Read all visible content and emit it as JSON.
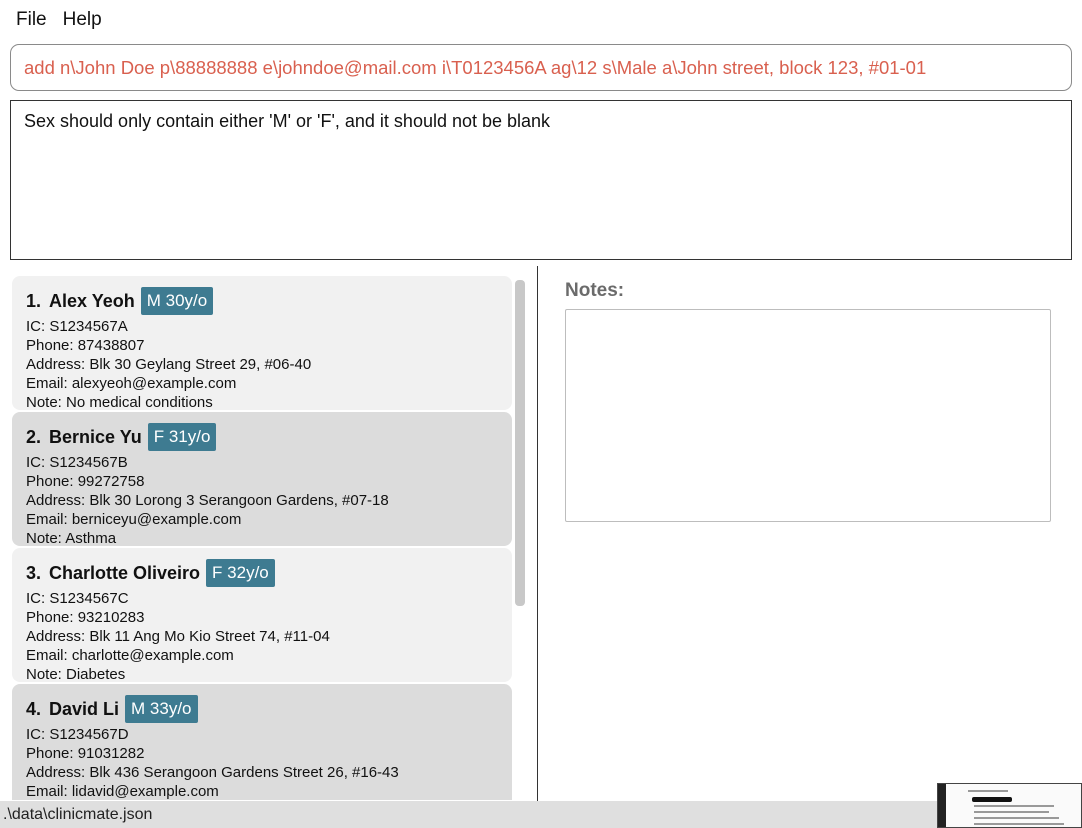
{
  "menu": {
    "file": "File",
    "help": "Help"
  },
  "command": {
    "value": "add n\\John Doe p\\88888888 e\\johndoe@mail.com i\\T0123456A ag\\12 s\\Male a\\John street, block 123, #01-01"
  },
  "result": {
    "message": "Sex should only contain either 'M' or 'F', and it should not be blank"
  },
  "persons": [
    {
      "index": "1.",
      "name": "Alex Yeoh",
      "badge": "M 30y/o",
      "ic": "IC: S1234567A",
      "phone": "Phone: 87438807",
      "address": "Address: Blk 30 Geylang Street 29, #06-40",
      "email": "Email: alexyeoh@example.com",
      "note": "Note: No medical conditions"
    },
    {
      "index": "2.",
      "name": "Bernice Yu",
      "badge": "F 31y/o",
      "ic": "IC: S1234567B",
      "phone": "Phone: 99272758",
      "address": "Address: Blk 30 Lorong 3 Serangoon Gardens, #07-18",
      "email": "Email: berniceyu@example.com",
      "note": "Note: Asthma"
    },
    {
      "index": "3.",
      "name": "Charlotte Oliveiro",
      "badge": "F 32y/o",
      "ic": "IC: S1234567C",
      "phone": "Phone: 93210283",
      "address": "Address: Blk 11 Ang Mo Kio Street 74, #11-04",
      "email": "Email: charlotte@example.com",
      "note": "Note: Diabetes"
    },
    {
      "index": "4.",
      "name": "David Li",
      "badge": "M 33y/o",
      "ic": "IC: S1234567D",
      "phone": "Phone: 91031282",
      "address": "Address: Blk 436 Serangoon Gardens Street 26, #16-43",
      "email": "Email: lidavid@example.com",
      "note": ""
    }
  ],
  "notes": {
    "label": "Notes:",
    "value": ""
  },
  "status": {
    "path": ".\\data\\clinicmate.json"
  },
  "colors": {
    "badge": "#3e7b91",
    "command_text": "#d9604f"
  }
}
